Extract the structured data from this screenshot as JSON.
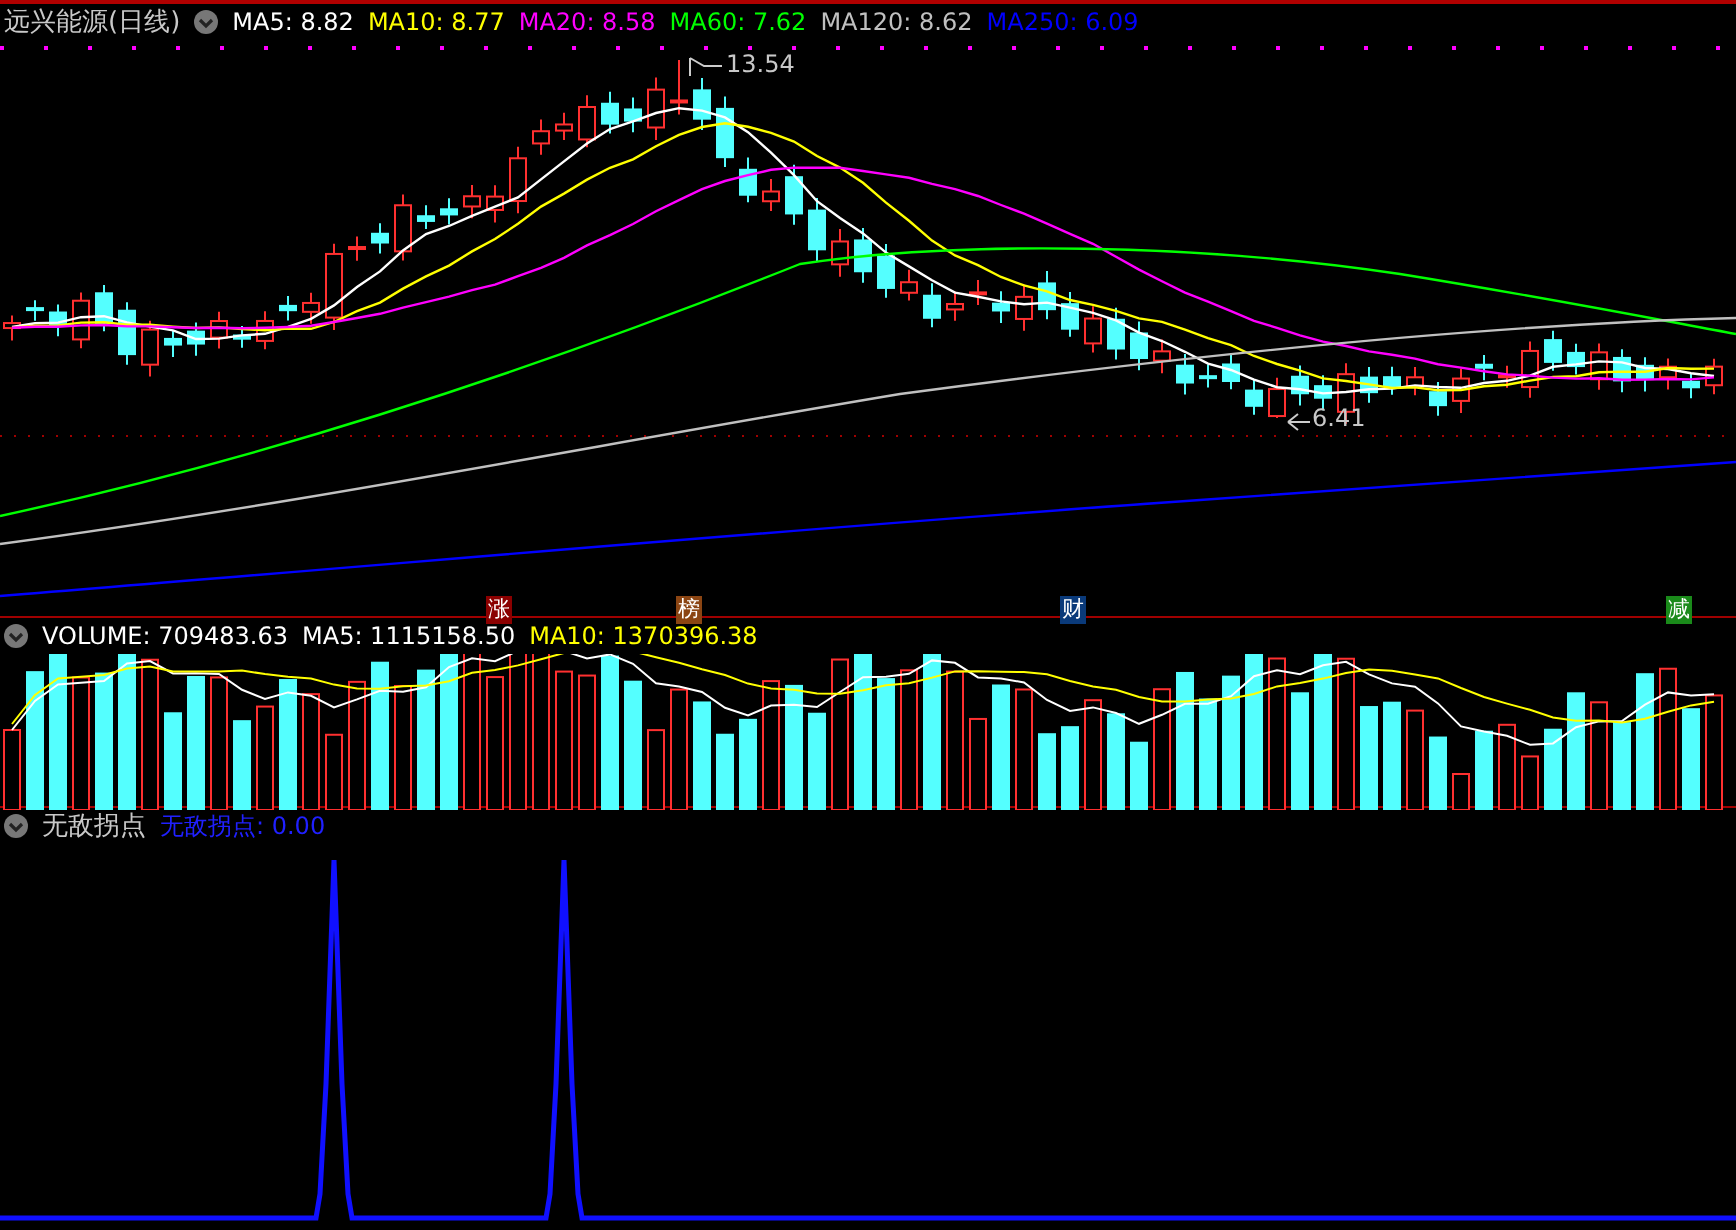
{
  "price_panel": {
    "title": "远兴能源(日线)",
    "ma_legend": [
      {
        "label": "MA5: 8.82",
        "color": "#ffffff"
      },
      {
        "label": "MA10: 8.77",
        "color": "#ffff00"
      },
      {
        "label": "MA20: 8.58",
        "color": "#ff00ff"
      },
      {
        "label": "MA60: 7.62",
        "color": "#00ff00"
      },
      {
        "label": "MA120: 8.62",
        "color": "#c0c0c0"
      },
      {
        "label": "MA250: 6.09",
        "color": "#0000ff"
      }
    ],
    "high_label": "13.54",
    "low_label": "6.41",
    "markers": [
      {
        "label": "涨",
        "color": "#8b0000"
      },
      {
        "label": "榜",
        "color": "#8b4513"
      },
      {
        "label": "财",
        "color": "#0a3a7a"
      },
      {
        "label": "减",
        "color": "#1a8a1a"
      }
    ]
  },
  "volume_panel": {
    "items": [
      {
        "label": "VOLUME: 709483.63",
        "color": "#ffffff"
      },
      {
        "label": "MA5: 1115158.50",
        "color": "#ffffff"
      },
      {
        "label": "MA10: 1370396.38",
        "color": "#ffff00"
      }
    ]
  },
  "indicator_panel": {
    "title": "无敌拐点",
    "value": "无敌拐点: 0.00"
  }
}
